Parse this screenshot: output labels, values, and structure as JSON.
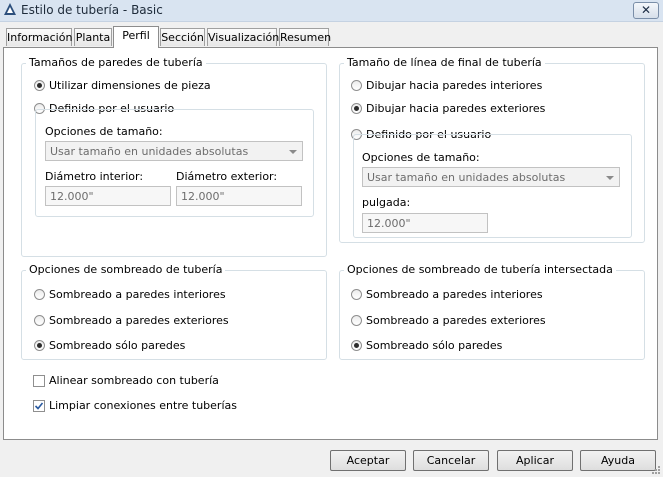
{
  "window": {
    "title": "Estilo de tubería - Basic",
    "close_glyph": "✕"
  },
  "tabs": [
    "Información",
    "Planta",
    "Perfil",
    "Sección",
    "Visualización",
    "Resumen"
  ],
  "active_tab": "Perfil",
  "wall_sizes": {
    "label": "Tamaños de paredes de tubería",
    "opt_part": "Utilizar dimensiones de pieza",
    "opt_user": "Definido por el usuario",
    "selected": "opt_part",
    "size_options_label": "Opciones de tamaño:",
    "size_options_value": "Usar tamaño en unidades absolutas",
    "inner_label": "Diámetro interior:",
    "inner_value": "12.000\"",
    "outer_label": "Diámetro exterior:",
    "outer_value": "12.000\""
  },
  "end_line": {
    "label": "Tamaño de línea de final de tubería",
    "opt_inner": "Dibujar hacia paredes interiores",
    "opt_outer": "Dibujar hacia paredes exteriores",
    "opt_user": "Definido por el usuario",
    "selected": "opt_outer",
    "size_options_label": "Opciones de tamaño:",
    "size_options_value": "Usar tamaño en unidades absolutas",
    "inch_label": "pulgada:",
    "inch_value": "12.000\""
  },
  "hatch": {
    "label": "Opciones de sombreado de tubería",
    "opt_inner": "Sombreado a paredes interiores",
    "opt_outer": "Sombreado a paredes exteriores",
    "opt_walls": "Sombreado sólo paredes",
    "selected": "opt_walls"
  },
  "hatch_intersect": {
    "label": "Opciones de sombreado de tubería intersectada",
    "opt_inner": "Sombreado a paredes interiores",
    "opt_outer": "Sombreado a paredes exteriores",
    "opt_walls": "Sombreado sólo paredes",
    "selected": "opt_walls"
  },
  "checks": {
    "align_label": "Alinear sombreado con tubería",
    "align_checked": false,
    "clean_label": "Limpiar conexiones entre tuberías",
    "clean_checked": true
  },
  "buttons": {
    "accept": "Aceptar",
    "cancel": "Cancelar",
    "apply": "Aplicar",
    "help": "Ayuda"
  },
  "colors": {
    "title_bar": "#d9e4f1",
    "group_border": "#d5dfe5",
    "check_mark": "#2a5aa0"
  }
}
